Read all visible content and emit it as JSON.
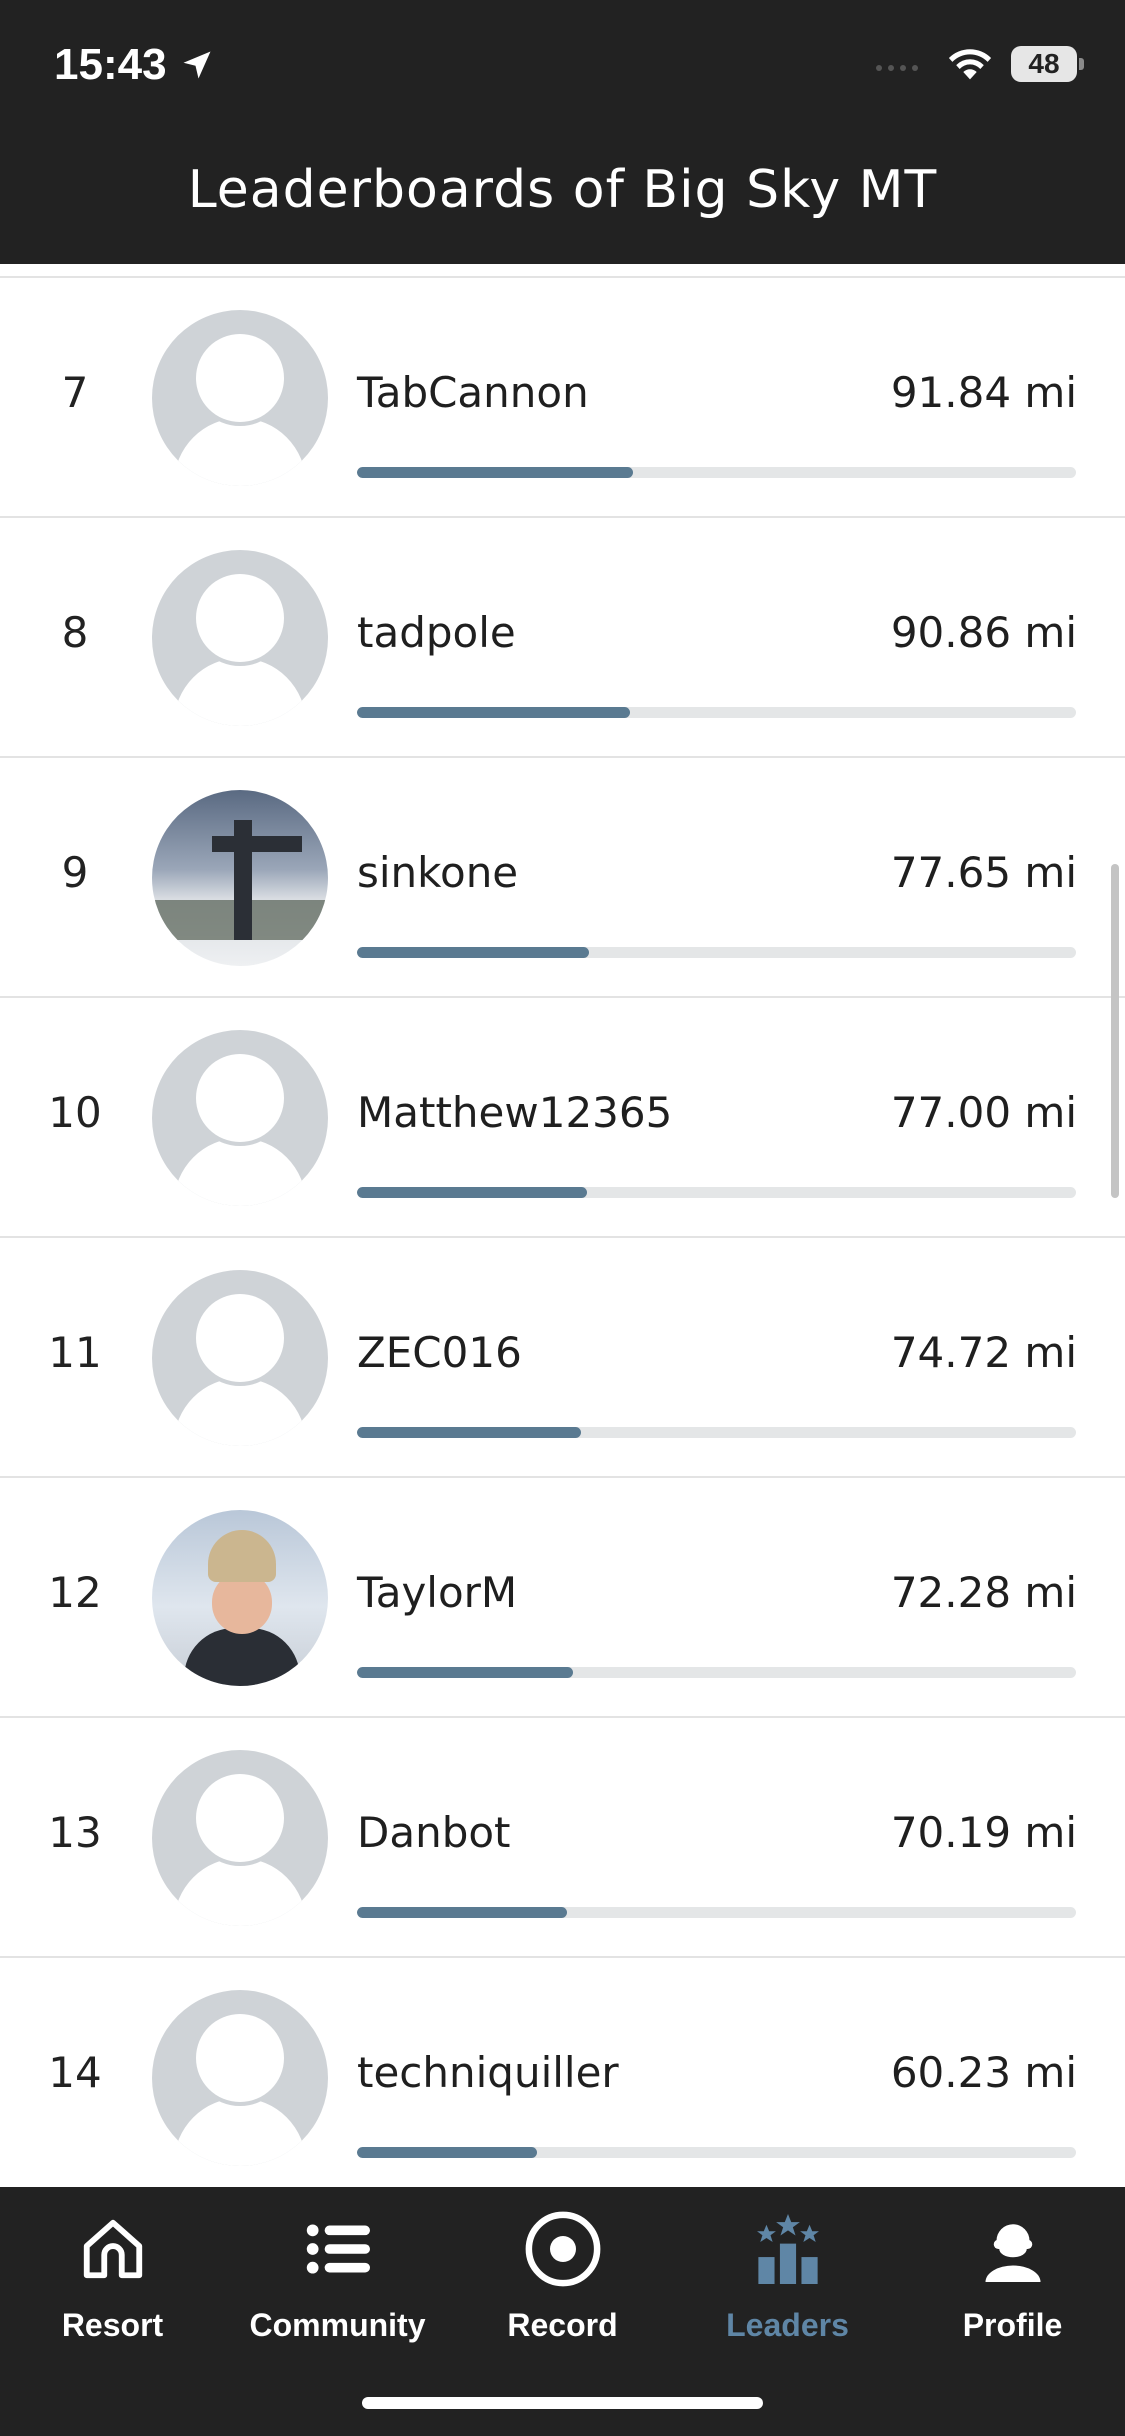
{
  "status": {
    "time": "15:43",
    "battery": "48"
  },
  "header": {
    "title": "Leaderboards of Big Sky MT"
  },
  "leaderboard": [
    {
      "rank": "7",
      "name": "TabCannon",
      "distance": "91.84 mi",
      "progress": 0.384,
      "avatar": "placeholder"
    },
    {
      "rank": "8",
      "name": "tadpole",
      "distance": "90.86 mi",
      "progress": 0.38,
      "avatar": "placeholder"
    },
    {
      "rank": "9",
      "name": "sinkone",
      "distance": "77.65 mi",
      "progress": 0.322,
      "avatar": "photo-chairlift"
    },
    {
      "rank": "10",
      "name": "Matthew12365",
      "distance": "77.00 mi",
      "progress": 0.32,
      "avatar": "placeholder"
    },
    {
      "rank": "11",
      "name": "ZEC016",
      "distance": "74.72 mi",
      "progress": 0.312,
      "avatar": "placeholder"
    },
    {
      "rank": "12",
      "name": "TaylorM",
      "distance": "72.28 mi",
      "progress": 0.3,
      "avatar": "photo-person"
    },
    {
      "rank": "13",
      "name": "Danbot",
      "distance": "70.19 mi",
      "progress": 0.292,
      "avatar": "placeholder"
    },
    {
      "rank": "14",
      "name": "techniquiller",
      "distance": "60.23 mi",
      "progress": 0.25,
      "avatar": "placeholder"
    }
  ],
  "tabs": [
    {
      "label": "Resort",
      "icon": "home-icon",
      "active": false
    },
    {
      "label": "Community",
      "icon": "list-icon",
      "active": false
    },
    {
      "label": "Record",
      "icon": "record-icon",
      "active": false
    },
    {
      "label": "Leaders",
      "icon": "leaderboard-icon",
      "active": true
    },
    {
      "label": "Profile",
      "icon": "profile-icon",
      "active": false
    }
  ],
  "colors": {
    "header_bg": "#222222",
    "accent": "#5f86a6",
    "bar_fill": "#5a7a91",
    "bar_track": "#e4e6e7"
  }
}
